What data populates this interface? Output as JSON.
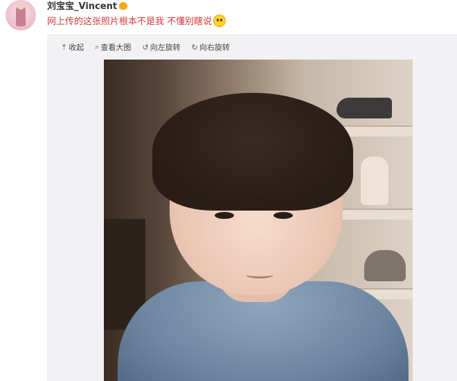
{
  "post": {
    "username": "刘宝宝_Vincent",
    "text": "网上传的这张照片根本不是我 不懂别瞎说"
  },
  "toolbar": {
    "collapse": "收起",
    "view_large": "查看大图",
    "rotate_left": "向左旋转",
    "rotate_right": "向右旋转"
  },
  "icons": {
    "badge": "crown-icon",
    "emoji": "smile-icon",
    "collapse": "collapse-up-icon",
    "view_large": "magnify-icon",
    "rotate_left": "rotate-left-icon",
    "rotate_right": "rotate-right-icon"
  },
  "colors": {
    "post_text": "#d23b3b",
    "username": "#333333",
    "media_bg": "#f2f2f5"
  }
}
